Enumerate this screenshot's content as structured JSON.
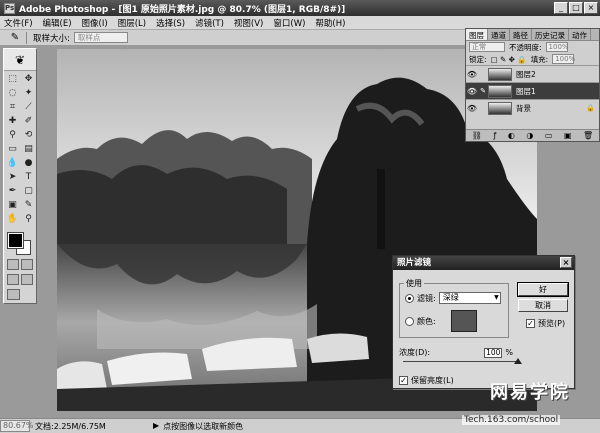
{
  "window": {
    "title": "Adobe Photoshop - [图1 原始照片素材.jpg @ 80.7% (图层1, RGB/8#)]",
    "min": "_",
    "max": "□",
    "close": "×"
  },
  "menu": [
    "文件(F)",
    "编辑(E)",
    "图像(I)",
    "图层(L)",
    "选择(S)",
    "滤镜(T)",
    "视图(V)",
    "窗口(W)",
    "帮助(H)"
  ],
  "options": {
    "label": "取样大小:",
    "value": "取样点"
  },
  "layers": {
    "tabs": [
      "图层",
      "通道",
      "路径",
      "历史记录",
      "动作"
    ],
    "blend_mode": "正常",
    "opacity_label": "不透明度:",
    "opacity_value": "100%",
    "lock_label": "锁定:",
    "fill_label": "填充:",
    "fill_value": "100%",
    "items": [
      {
        "name": "图层2",
        "selected": false
      },
      {
        "name": "图层1",
        "selected": true
      },
      {
        "name": "背景",
        "selected": false,
        "locked": true
      }
    ]
  },
  "dialog": {
    "title": "照片滤镜",
    "group_label": "使用",
    "filter_label": "滤镜:",
    "filter_value": "深绿",
    "color_label": "颜色:",
    "ok": "好",
    "cancel": "取消",
    "preview": "预览(P)",
    "density_label": "浓度(D):",
    "density_value": "100",
    "density_unit": "%",
    "preserve": "保留亮度(L)",
    "density_level_percent": 100
  },
  "status": {
    "zoom": "80.67%",
    "doc": "文档:2.25M/6.75M",
    "hint": "点按图像以选取新颜色"
  },
  "watermark": {
    "url": "Tech.163.com/school",
    "logo": "网易学院"
  },
  "colors": {
    "foreground": "#000000",
    "background": "#ffffff"
  }
}
